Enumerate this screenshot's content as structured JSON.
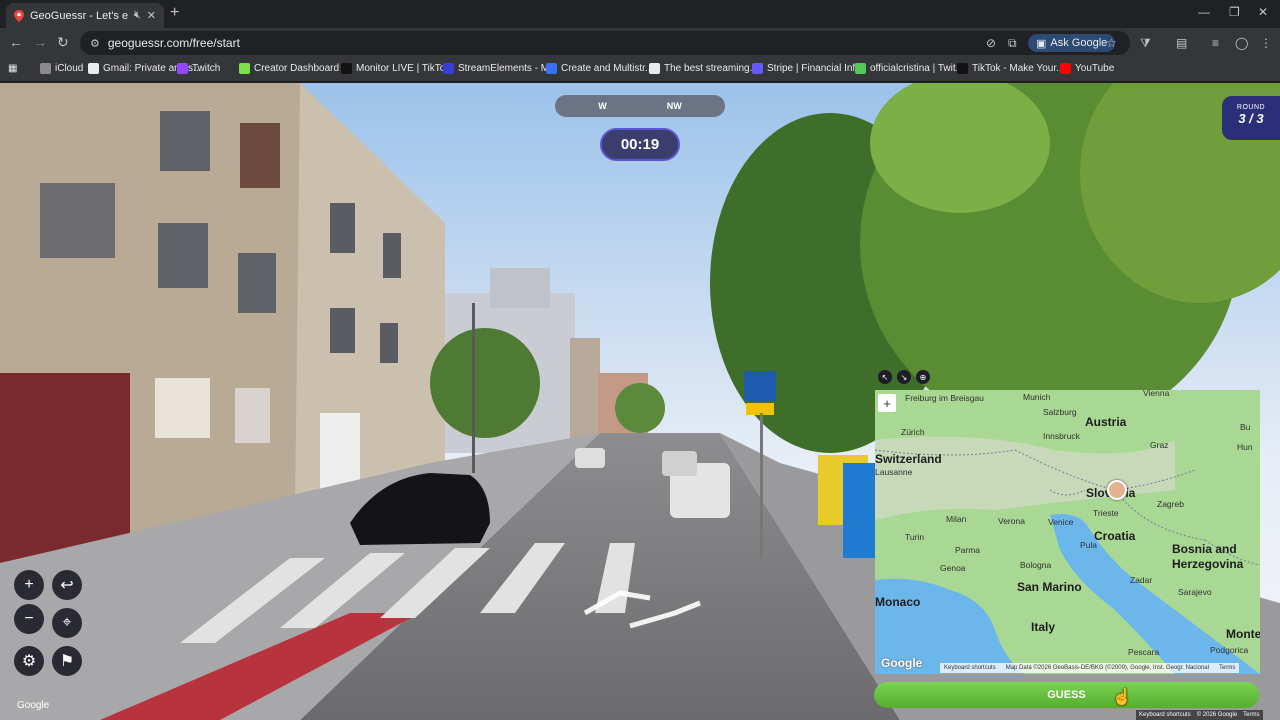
{
  "browser": {
    "tab_title": "GeoGuessr - Let's explore t",
    "url": "geoguessr.com/free/start",
    "ask_google": "Ask Google",
    "bookmarks": [
      {
        "label": "iCloud",
        "color": "#8a8a8a"
      },
      {
        "label": "Gmail: Private and s...",
        "color": "#e8eaed"
      },
      {
        "label": "Twitch",
        "color": "#9146ff"
      },
      {
        "label": "Creator Dashboard |...",
        "color": "#7be04a"
      },
      {
        "label": "Monitor LIVE | TikTo...",
        "color": "#111111"
      },
      {
        "label": "StreamElements - M...",
        "color": "#3b3bd6"
      },
      {
        "label": "Create and Multistr...",
        "color": "#3b6ff6"
      },
      {
        "label": "The best streaming...",
        "color": "#e8eaed"
      },
      {
        "label": "Stripe | Financial Infr...",
        "color": "#635bff"
      },
      {
        "label": "officialcristina | Twit...",
        "color": "#54c754"
      },
      {
        "label": "TikTok - Make Your...",
        "color": "#111111"
      },
      {
        "label": "YouTube",
        "color": "#ff0000"
      }
    ]
  },
  "game": {
    "compass": {
      "left": "W",
      "right": "NW"
    },
    "timer": "00:19",
    "round_label": "ROUND",
    "round_value": "3 / 3",
    "sv_google": "Google",
    "guess_label": "GUESS"
  },
  "map": {
    "countries": [
      "Austria",
      "Switzerland",
      "Slovenia",
      "Croatia",
      "Bosnia and",
      "Herzegovina",
      "Italy",
      "San Marino",
      "Monaco",
      "Monte"
    ],
    "cities": [
      "Munich",
      "Vienna",
      "Freiburg im Breisgau",
      "Salzburg",
      "Zürich",
      "Innsbruck",
      "Graz",
      "Bu",
      "Hun",
      "Lausanne",
      "Zagreb",
      "Trieste",
      "Milan",
      "Verona",
      "Venice",
      "Turin",
      "Parma",
      "Pula",
      "Bologna",
      "Genoa",
      "Zadar",
      "Sarajevo",
      "Pescara",
      "Podgorica"
    ],
    "google": "Google",
    "attribution": [
      "Keyboard shortcuts",
      "Map Data ©2026 GeoBasis-DE/BKG (©2009), Google, Inst. Geogr. Nacional",
      "Terms"
    ]
  },
  "footer": [
    "Keyboard shortcuts",
    "© 2026 Google",
    "Terms"
  ],
  "colors": {
    "accent": "#5b57d1",
    "guess_green": "#6cc341",
    "round_bg": "#2b2f7a"
  }
}
